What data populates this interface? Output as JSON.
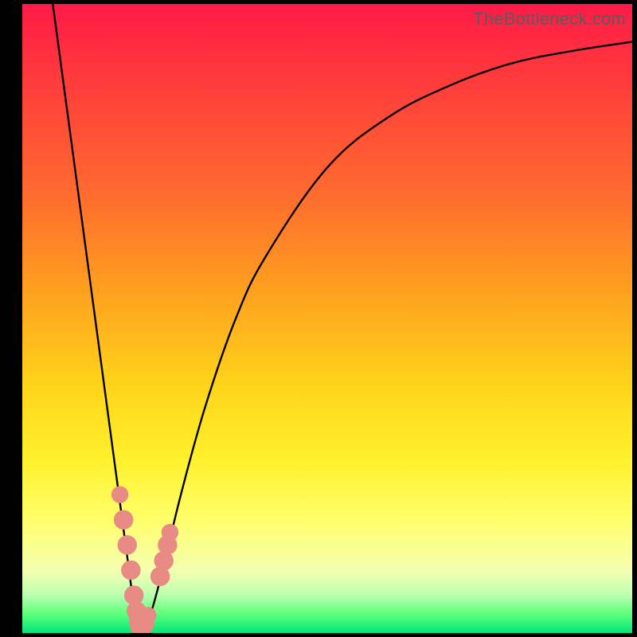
{
  "watermark": "TheBottleneck.com",
  "colors": {
    "frame": "#000000",
    "curve_stroke": "#000000",
    "marker_fill": "#e98b85",
    "gradient_top": "#ff1a48",
    "gradient_bottom": "#00e67a"
  },
  "chart_data": {
    "type": "line",
    "title": "",
    "xlabel": "",
    "ylabel": "",
    "xlim": [
      0,
      100
    ],
    "ylim": [
      0,
      100
    ],
    "grid": false,
    "series": [
      {
        "name": "bottleneck-curve",
        "x": [
          5,
          7.5,
          10,
          12.5,
          15,
          17.5,
          18.5,
          19.5,
          21,
          23,
          26,
          30,
          35,
          40,
          50,
          60,
          70,
          80,
          90,
          100
        ],
        "y": [
          100,
          82,
          64,
          46,
          28,
          10,
          3,
          1,
          3,
          10,
          22,
          36,
          50,
          60,
          74,
          82,
          87,
          90.5,
          92.5,
          94
        ]
      }
    ],
    "markers": [
      {
        "x": 16.0,
        "y": 22,
        "r": 1.4
      },
      {
        "x": 16.6,
        "y": 18,
        "r": 1.6
      },
      {
        "x": 17.2,
        "y": 14,
        "r": 1.6
      },
      {
        "x": 17.8,
        "y": 10,
        "r": 1.6
      },
      {
        "x": 18.3,
        "y": 6,
        "r": 1.6
      },
      {
        "x": 18.7,
        "y": 3.5,
        "r": 1.6
      },
      {
        "x": 19.1,
        "y": 1.8,
        "r": 1.6
      },
      {
        "x": 19.5,
        "y": 1.0,
        "r": 1.8
      },
      {
        "x": 20.0,
        "y": 1.4,
        "r": 1.6
      },
      {
        "x": 20.6,
        "y": 2.8,
        "r": 1.4
      },
      {
        "x": 22.6,
        "y": 9.0,
        "r": 1.6
      },
      {
        "x": 23.2,
        "y": 11.5,
        "r": 1.6
      },
      {
        "x": 23.8,
        "y": 14.0,
        "r": 1.6
      },
      {
        "x": 24.2,
        "y": 16.0,
        "r": 1.4
      }
    ]
  }
}
